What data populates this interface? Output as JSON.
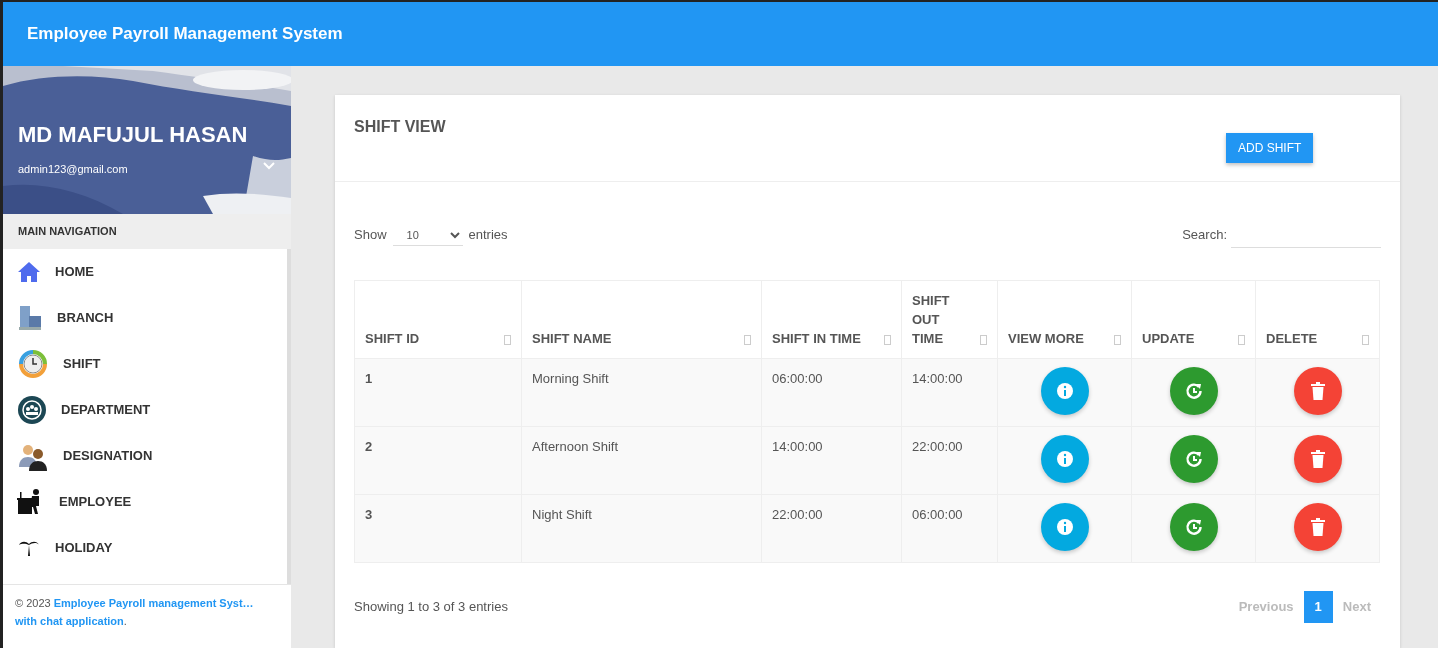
{
  "app_title": "Employee Payroll Management System",
  "user": {
    "name": "MD MAFUJUL HASAN",
    "email": "admin123@gmail.com"
  },
  "sidebar": {
    "heading": "MAIN NAVIGATION",
    "items": [
      {
        "label": "HOME",
        "kind": "home"
      },
      {
        "label": "BRANCH",
        "kind": "branch"
      },
      {
        "label": "SHIFT",
        "kind": "shift"
      },
      {
        "label": "DEPARTMENT",
        "kind": "department"
      },
      {
        "label": "DESIGNATION",
        "kind": "designation"
      },
      {
        "label": "EMPLOYEE",
        "kind": "employee"
      },
      {
        "label": "HOLIDAY",
        "kind": "holiday"
      }
    ]
  },
  "footer": {
    "prefix": "© 2023",
    "links": [
      "Employee Payroll management Syst…",
      "with chat application"
    ],
    "suffix": "."
  },
  "card": {
    "title": "SHIFT VIEW",
    "add_button": "ADD SHIFT"
  },
  "length_control": {
    "before": "Show",
    "value": "10",
    "after": "entries"
  },
  "search": {
    "label": "Search:"
  },
  "table": {
    "columns": [
      "SHIFT ID",
      "SHIFT NAME",
      "SHIFT IN TIME",
      "SHIFT OUT TIME",
      "VIEW MORE",
      "UPDATE",
      "DELETE"
    ],
    "rows": [
      {
        "id": "1",
        "name": "Morning Shift",
        "in": "06:00:00",
        "out": "14:00:00"
      },
      {
        "id": "2",
        "name": "Afternoon Shift",
        "in": "14:00:00",
        "out": "22:00:00"
      },
      {
        "id": "3",
        "name": "Night Shift",
        "in": "22:00:00",
        "out": "06:00:00"
      }
    ]
  },
  "info": "Showing 1 to 3 of 3 entries",
  "pagination": [
    {
      "label": "Previous",
      "kind": "prev",
      "selected": false
    },
    {
      "label": "1",
      "kind": "page",
      "selected": true
    },
    {
      "label": "Next",
      "kind": "next",
      "selected": false
    }
  ]
}
